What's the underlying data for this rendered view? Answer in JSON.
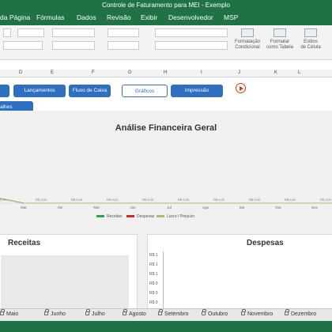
{
  "window": {
    "title": "Controle de Faturamento para MEI - Exemplo"
  },
  "ribbon_tabs": [
    "da Página",
    "Fórmulas",
    "Dados",
    "Revisão",
    "Exibir",
    "Desenvolvedor",
    "MSP"
  ],
  "ribbon_buttons": {
    "cond_format": [
      "Formatação",
      "Condicional"
    ],
    "format_table": [
      "Formatar",
      "como Tabela"
    ],
    "cell_styles": [
      "Estilos",
      "de Célula"
    ]
  },
  "columns": [
    "D",
    "E",
    "F",
    "G",
    "H",
    "I",
    "J",
    "K",
    "L"
  ],
  "nav": {
    "lancamentos": "Lançamentos",
    "fluxo": "Fluxo de Caixa",
    "graficos": "Gráficos",
    "impressao": "Impressão",
    "detalhes": "alhes"
  },
  "chart_data": [
    {
      "type": "line",
      "title": "Análise Financeira Geral",
      "x": [
        "Mar",
        "Abr",
        "Mai",
        "Jun",
        "Jul",
        "Ago",
        "Set",
        "Out",
        "Nov"
      ],
      "series": [
        {
          "name": "Receitas",
          "color": "#2da44e",
          "values": [
            0,
            0,
            0,
            0,
            0,
            0,
            0,
            0,
            0
          ]
        },
        {
          "name": "Despesas",
          "color": "#d62728",
          "values": [
            0,
            0,
            0,
            0,
            0,
            0,
            0,
            0,
            0
          ]
        },
        {
          "name": "Lucro / Prejuízo",
          "color": "#b5b86a",
          "values": [
            0,
            0,
            0,
            0,
            0,
            0,
            0,
            0,
            0
          ]
        }
      ],
      "point_labels": [
        "0,00",
        "R$ 0,00",
        "R$ 0,00",
        "R$ 0,00",
        "R$ 0,00",
        "R$ 0,00",
        "R$ 0,00",
        "R$ 0,00",
        "R$ 0,00",
        "R$ 0,00",
        "R$ 0,00"
      ],
      "legend": "bottom"
    },
    {
      "type": "bar",
      "title": "Despesas",
      "yticks": [
        "R$ 1",
        "R$ 1",
        "R$ 1",
        "R$ 0",
        "R$ 0",
        "R$ 0"
      ]
    }
  ],
  "panels": {
    "receitas": "Receitas"
  },
  "sheet_tabs": [
    "Maio",
    "Junho",
    "Julho",
    "Agosto",
    "Setembro",
    "Outubro",
    "Novembro",
    "Dezembro"
  ]
}
